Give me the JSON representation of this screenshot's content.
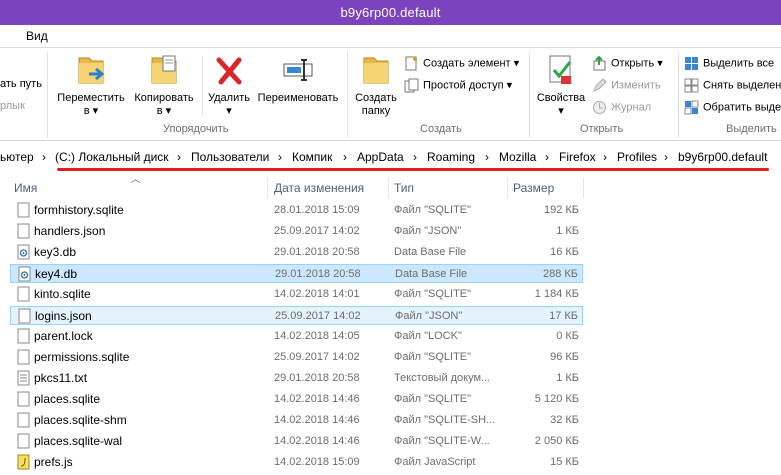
{
  "window": {
    "title": "b9y6rp00.default"
  },
  "tabs": {
    "view": "Вид"
  },
  "ribbon": {
    "left_partial_1": "ать путь",
    "left_partial_2": "рлык",
    "move_to": [
      "Переместить",
      "в"
    ],
    "copy_to": [
      "Копировать",
      "в"
    ],
    "delete": [
      "Удалить"
    ],
    "rename": "Переименовать",
    "organize_label": "Упорядочить",
    "new_folder": [
      "Создать",
      "папку"
    ],
    "new_item": "Создать элемент",
    "easy_access": "Простой доступ",
    "create_label": "Создать",
    "properties": [
      "Свойства"
    ],
    "open": "Открыть",
    "edit": "Изменить",
    "history": "Журнал",
    "open_label": "Открыть",
    "select_all": "Выделить все",
    "select_none": "Снять выделен",
    "invert_selection": "Обратить выде",
    "select_label": "Выделить"
  },
  "address": {
    "segments": [
      "ьютер",
      "(C:) Локальный диск",
      "Пользователи",
      "Компик",
      "AppData",
      "Roaming",
      "Mozilla",
      "Firefox",
      "Profiles",
      "b9y6rp00.default"
    ]
  },
  "columns": {
    "name": "Имя",
    "date": "Дата изменения",
    "type": "Тип",
    "size": "Размер"
  },
  "files": [
    {
      "name": "formhistory.sqlite",
      "date": "28.01.2018 15:09",
      "type": "Файл \"SQLITE\"",
      "size": "192 КБ",
      "icon": "file-icon",
      "state": ""
    },
    {
      "name": "handlers.json",
      "date": "25.09.2017 14:02",
      "type": "Файл \"JSON\"",
      "size": "1 КБ",
      "icon": "file-icon",
      "state": ""
    },
    {
      "name": "key3.db",
      "date": "29.01.2018 20:58",
      "type": "Data Base File",
      "size": "16 КБ",
      "icon": "db-file-icon",
      "state": ""
    },
    {
      "name": "key4.db",
      "date": "29.01.2018 20:58",
      "type": "Data Base File",
      "size": "288 КБ",
      "icon": "db-file-icon",
      "state": "selected"
    },
    {
      "name": "kinto.sqlite",
      "date": "14.02.2018 14:01",
      "type": "Файл \"SQLITE\"",
      "size": "1 184 КБ",
      "icon": "file-icon",
      "state": ""
    },
    {
      "name": "logins.json",
      "date": "25.09.2017 14:02",
      "type": "Файл \"JSON\"",
      "size": "17 КБ",
      "icon": "file-icon",
      "state": "focused"
    },
    {
      "name": "parent.lock",
      "date": "14.02.2018 14:05",
      "type": "Файл \"LOCK\"",
      "size": "0 КБ",
      "icon": "file-icon",
      "state": ""
    },
    {
      "name": "permissions.sqlite",
      "date": "25.09.2017 14:02",
      "type": "Файл \"SQLITE\"",
      "size": "96 КБ",
      "icon": "file-icon",
      "state": ""
    },
    {
      "name": "pkcs11.txt",
      "date": "29.01.2018 20:58",
      "type": "Текстовый докум...",
      "size": "1 КБ",
      "icon": "text-file-icon",
      "state": ""
    },
    {
      "name": "places.sqlite",
      "date": "14.02.2018 14:46",
      "type": "Файл \"SQLITE\"",
      "size": "5 120 КБ",
      "icon": "file-icon",
      "state": ""
    },
    {
      "name": "places.sqlite-shm",
      "date": "14.02.2018 14:46",
      "type": "Файл \"SQLITE-SH...",
      "size": "32 КБ",
      "icon": "file-icon",
      "state": ""
    },
    {
      "name": "places.sqlite-wal",
      "date": "14.02.2018 14:46",
      "type": "Файл \"SQLITE-W...",
      "size": "2 050 КБ",
      "icon": "file-icon",
      "state": ""
    },
    {
      "name": "prefs.js",
      "date": "14.02.2018 15:09",
      "type": "Файл JavaScript",
      "size": "15 КБ",
      "icon": "js-file-icon",
      "state": ""
    }
  ],
  "colors": {
    "titlebar": "#7b44be",
    "selection": "#cce8ff",
    "underline": "#e01c1c"
  }
}
